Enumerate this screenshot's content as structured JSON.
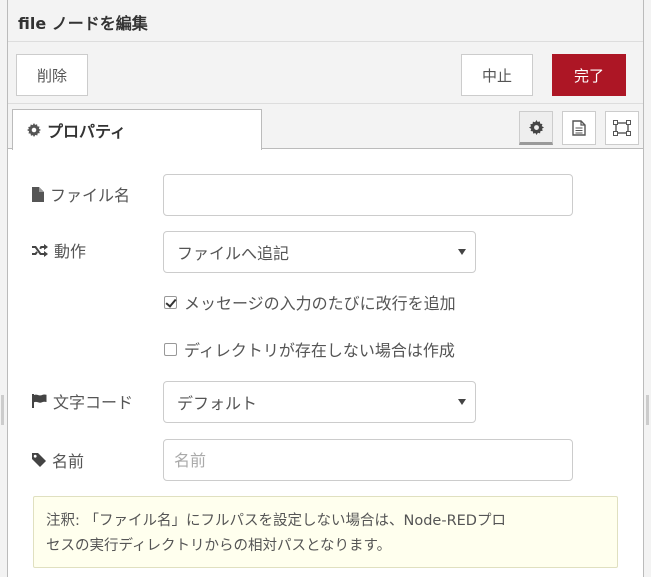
{
  "tray": {
    "title": "file ノードを編集"
  },
  "toolbar": {
    "delete_label": "削除",
    "cancel_label": "中止",
    "done_label": "完了"
  },
  "tabs": {
    "properties_label": "プロパティ"
  },
  "form": {
    "filename": {
      "label": "ファイル名",
      "value": "",
      "placeholder": ""
    },
    "action": {
      "label": "動作",
      "value": "ファイルへ追記"
    },
    "append_newline": {
      "label": "メッセージの入力のたびに改行を追加",
      "checked": true
    },
    "create_dir": {
      "label": "ディレクトリが存在しない場合は作成",
      "checked": false
    },
    "encoding": {
      "label": "文字コード",
      "value": "デフォルト"
    },
    "name": {
      "label": "名前",
      "value": "",
      "placeholder": "名前"
    },
    "tip": {
      "line1": "注釈: 「ファイル名」にフルパスを設定しない場合は、Node-REDプロ",
      "line2": "セスの実行ディレクトリからの相対パスとなります。"
    }
  },
  "colors": {
    "primary": "#ad1625",
    "tip_background": "#ffffee"
  }
}
